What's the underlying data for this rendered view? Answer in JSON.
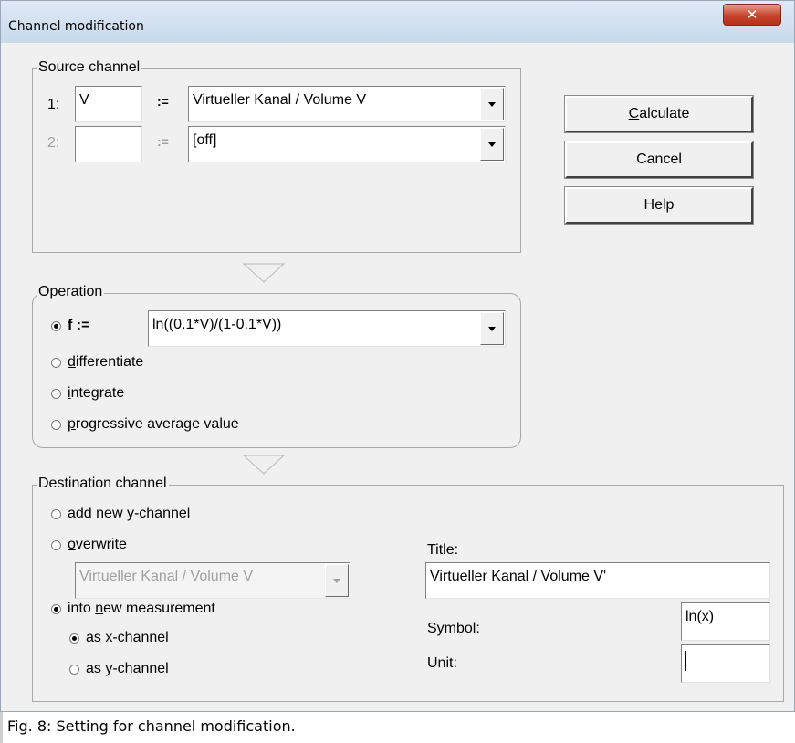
{
  "window": {
    "title": "Channel modification"
  },
  "source": {
    "group_label": "Source channel",
    "row1": {
      "num": "1:",
      "var": "V",
      "assign": ":=",
      "channel": "Virtueller Kanal / Volume V"
    },
    "row2": {
      "num": "2:",
      "var": "",
      "assign": ":=",
      "channel": "[off]"
    }
  },
  "buttons": {
    "calculate_rest": "alculate",
    "calculate_accel": "C",
    "cancel": "Cancel",
    "help": "Help"
  },
  "operation": {
    "group_label": "Operation",
    "f_label": "f :=",
    "formula": "ln((0.1*V)/(1-0.1*V))",
    "differentiate_accel": "d",
    "differentiate_rest": "ifferentiate",
    "integrate_accel": "i",
    "integrate_rest": "ntegrate",
    "progressive_accel": "p",
    "progressive_rest": "rogressive average value"
  },
  "destination": {
    "group_label": "Destination channel",
    "add_new": "add new y-channel",
    "overwrite_accel": "o",
    "overwrite_rest": "verwrite",
    "overwrite_channel": "Virtueller Kanal / Volume V",
    "into_pre": "into ",
    "into_accel": "n",
    "into_rest": "ew measurement",
    "as_x": "as x-channel",
    "as_y": "as y-channel",
    "title_label": "Title:",
    "title_value": "Virtueller Kanal / Volume V'",
    "symbol_label": "Symbol:",
    "symbol_value": "ln(x)",
    "unit_label": "Unit:",
    "unit_value": ""
  },
  "caption": "Fig. 8: Setting for channel modification."
}
